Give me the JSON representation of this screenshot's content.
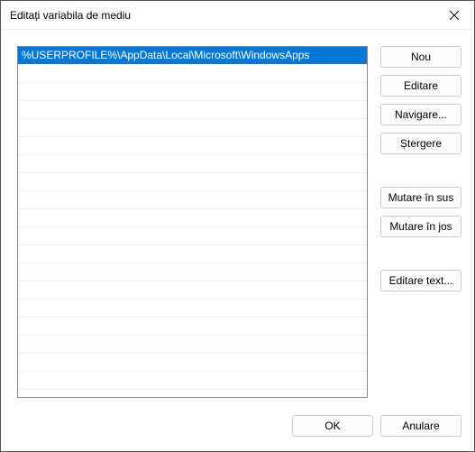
{
  "window": {
    "title": "Editați variabila de mediu"
  },
  "list": {
    "items": [
      "%USERPROFILE%\\AppData\\Local\\Microsoft\\WindowsApps"
    ],
    "selectedIndex": 0,
    "visibleRows": 19
  },
  "buttons": {
    "new": "Nou",
    "edit": "Editare",
    "browse": "Navigare...",
    "delete": "Ștergere",
    "moveUp": "Mutare în sus",
    "moveDown": "Mutare în jos",
    "editText": "Editare text...",
    "ok": "OK",
    "cancel": "Anulare"
  }
}
